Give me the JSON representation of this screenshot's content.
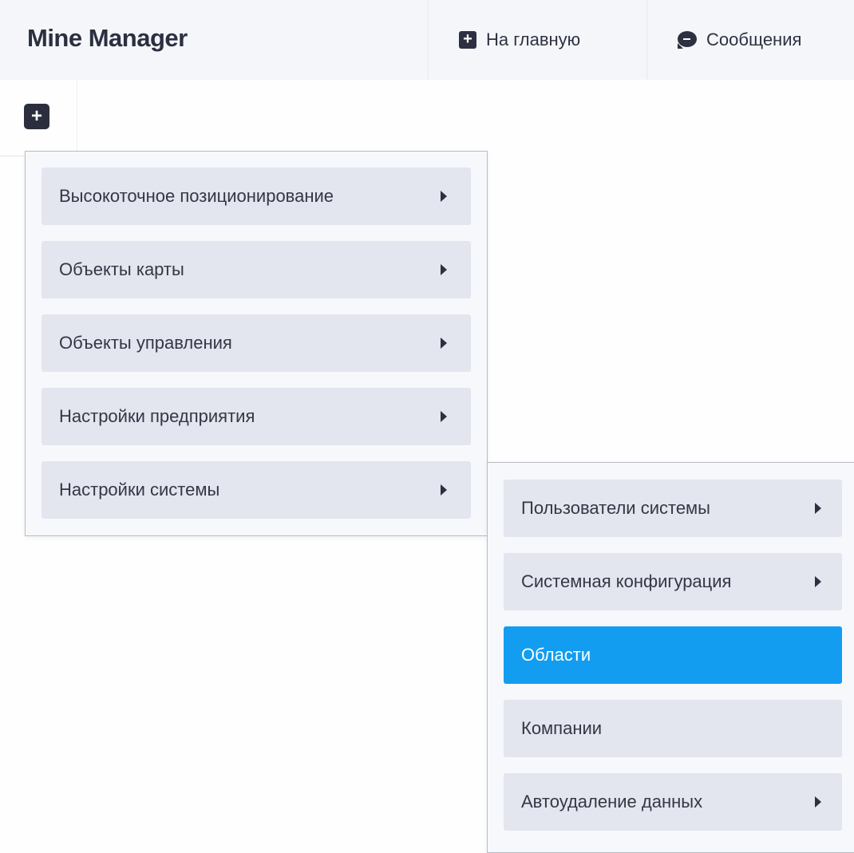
{
  "app": {
    "title": "Mine Manager"
  },
  "nav": {
    "home": {
      "label": "На главную",
      "icon": "plus-square-icon"
    },
    "messages": {
      "label": "Сообщения",
      "icon": "chat-bubble-icon"
    }
  },
  "toolbar": {
    "add_symbol": "+"
  },
  "menu": {
    "items": [
      {
        "label": "Высокоточное позиционирование",
        "has_submenu": true
      },
      {
        "label": "Объекты карты",
        "has_submenu": true
      },
      {
        "label": "Объекты управления",
        "has_submenu": true
      },
      {
        "label": "Настройки предприятия",
        "has_submenu": true
      },
      {
        "label": "Настройки системы",
        "has_submenu": true
      }
    ]
  },
  "submenu": {
    "items": [
      {
        "label": "Пользователи системы",
        "has_submenu": true
      },
      {
        "label": "Системная конфигурация",
        "has_submenu": true
      },
      {
        "label": "Области",
        "has_submenu": false,
        "active": true
      },
      {
        "label": "Компании",
        "has_submenu": false
      },
      {
        "label": "Автоудаление данных",
        "has_submenu": true
      }
    ]
  },
  "colors": {
    "accent": "#129df0",
    "item_bg": "#e3e5ef",
    "dark": "#2c3040"
  }
}
